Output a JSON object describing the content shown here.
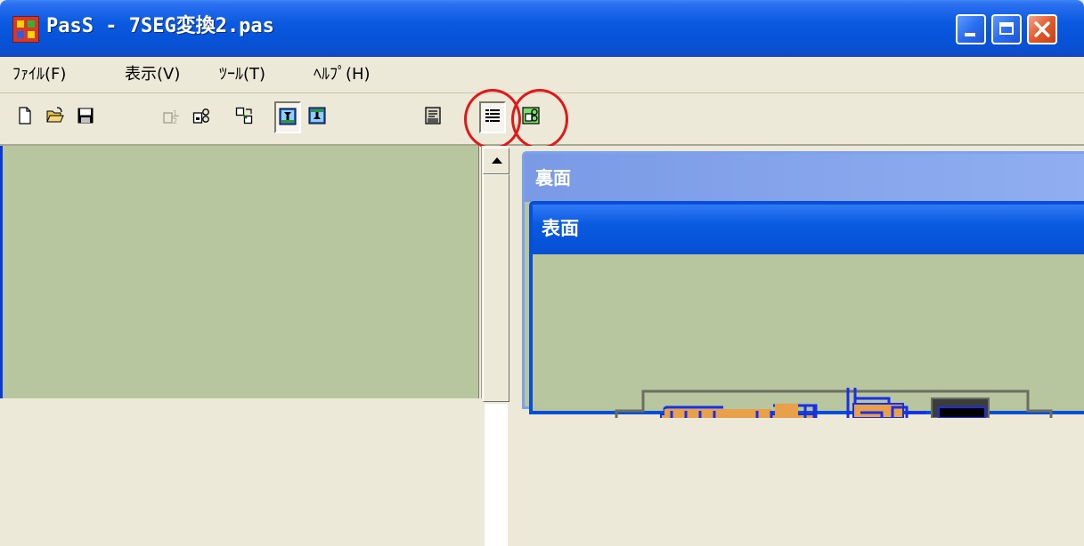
{
  "window": {
    "title": "PasS - 7SEG変換2.pas"
  },
  "menu": {
    "items": [
      {
        "label": "ﾌｧｲﾙ(F)"
      },
      {
        "label": "表示(V)"
      },
      {
        "label": "ﾂｰﾙ(T)"
      },
      {
        "label": "ﾍﾙﾌﾟ(H)"
      }
    ]
  },
  "toolbar": {
    "buttons": [
      {
        "icon": "new-file-icon"
      },
      {
        "icon": "open-folder-icon"
      },
      {
        "icon": "save-icon"
      },
      {
        "icon": "layer-disabled-icon"
      },
      {
        "icon": "layer-edit-icon"
      },
      {
        "icon": "component-select-icon"
      },
      {
        "icon": "flip-front-icon"
      },
      {
        "icon": "flip-back-icon"
      },
      {
        "icon": "msg-icon"
      },
      {
        "icon": "list-settings-icon"
      },
      {
        "icon": "green-config-icon"
      }
    ]
  },
  "mdi": {
    "back_window_title": "裏面",
    "front_window_title": "表面"
  },
  "colors": {
    "board_background": "#b7c69f",
    "trace": "#1a2ee6",
    "pad": "#e9a04a",
    "highlight": "#e01818"
  }
}
